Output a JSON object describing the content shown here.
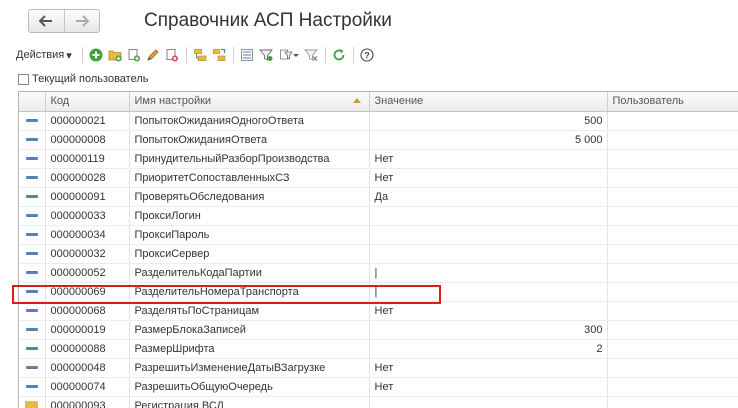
{
  "window": {
    "title": "Справочник АСП Настройки",
    "nav_back": "🡐",
    "nav_forward": "🡒"
  },
  "toolbar": {
    "actions_label": "Действия",
    "actions_arrow": "▾",
    "icons": [
      "add-icon",
      "add-folder-icon",
      "copy-icon",
      "edit-icon",
      "delete-icon",
      "move-to-folder-icon",
      "hierarchy-icon",
      "filter-icon",
      "filter-by-value-icon",
      "filter-dropdown-icon",
      "clear-filter-icon",
      "refresh-icon",
      "help-icon"
    ]
  },
  "filter": {
    "current_user_label": "Текущий пользователь"
  },
  "table": {
    "columns": {
      "code": "Код",
      "name": "Имя настройки",
      "value": "Значение",
      "user": "Пользователь"
    },
    "rows": [
      {
        "code": "000000021",
        "name": "ПопытокОжиданияОдногоОтвета",
        "value": "500",
        "user": ""
      },
      {
        "code": "000000008",
        "name": "ПопытокОжиданияОтвета",
        "value": "5 000",
        "user": ""
      },
      {
        "code": "000000119",
        "name": "ПринудительныйРазборПроизводства",
        "value": "Нет",
        "user": ""
      },
      {
        "code": "000000028",
        "name": "ПриоритетСопоставленныхСЗ",
        "value": "Нет",
        "user": ""
      },
      {
        "code": "000000091",
        "name": "ПроверятьОбследования",
        "value": "Да",
        "user": ""
      },
      {
        "code": "000000033",
        "name": "ПроксиЛогин",
        "value": "",
        "user": ""
      },
      {
        "code": "000000034",
        "name": "ПроксиПароль",
        "value": "",
        "user": ""
      },
      {
        "code": "000000032",
        "name": "ПроксиСервер",
        "value": "",
        "user": ""
      },
      {
        "code": "000000052",
        "name": "РазделительКодаПартии",
        "value": "|",
        "user": ""
      },
      {
        "code": "000000069",
        "name": "РазделительНомераТранспорта",
        "value": "|",
        "user": ""
      },
      {
        "code": "000000068",
        "name": "РазделятьПоСтраницам",
        "value": "Нет",
        "user": ""
      },
      {
        "code": "000000019",
        "name": "РазмерБлокаЗаписей",
        "value": "300",
        "user": ""
      },
      {
        "code": "000000088",
        "name": "РазмерШрифта",
        "value": "2",
        "user": ""
      },
      {
        "code": "000000048",
        "name": "РазрешитьИзменениеДатыВЗагрузке",
        "value": "Нет",
        "user": ""
      },
      {
        "code": "000000074",
        "name": "РазрешитьОбщуюОчередь",
        "value": "Нет",
        "user": ""
      },
      {
        "code": "000000093",
        "name": "Регистрация ВСД",
        "value": "",
        "user": ""
      }
    ]
  },
  "colors": {
    "highlight": "#e01b1b",
    "row_marker": "#5b7fae"
  }
}
